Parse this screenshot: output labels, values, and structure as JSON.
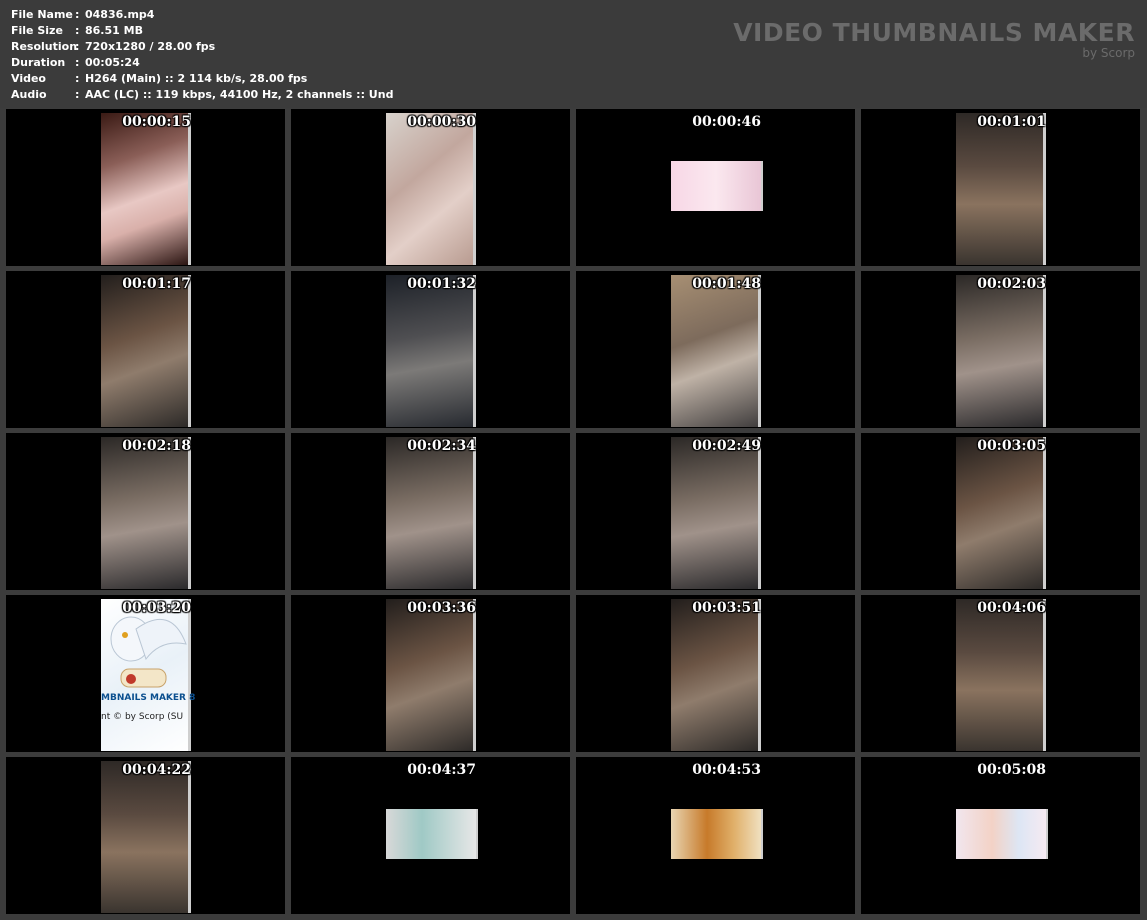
{
  "meta": {
    "rows": [
      {
        "key": "File Name",
        "sep": ":",
        "value": "04836.mp4"
      },
      {
        "key": "File Size",
        "sep": ":",
        "value": "86.51 MB"
      },
      {
        "key": "Resolution",
        "sep": ":",
        "value": "720x1280 / 28.00 fps"
      },
      {
        "key": "Duration",
        "sep": ":",
        "value": "00:05:24"
      },
      {
        "key": "Video",
        "sep": ":",
        "value": "H264 (Main) :: 2 114 kb/s, 28.00 fps"
      },
      {
        "key": "Audio",
        "sep": ":",
        "value": "AAC (LC) :: 119 kbps, 44100 Hz, 2 channels :: Und"
      }
    ]
  },
  "brand": {
    "title": "VIDEO THUMBNAILS MAKER",
    "by": "by Scorp"
  },
  "thumbnails": [
    {
      "time": "00:00:15"
    },
    {
      "time": "00:00:30"
    },
    {
      "time": "00:00:46"
    },
    {
      "time": "00:01:01"
    },
    {
      "time": "00:01:17"
    },
    {
      "time": "00:01:32"
    },
    {
      "time": "00:01:48"
    },
    {
      "time": "00:02:03"
    },
    {
      "time": "00:02:18"
    },
    {
      "time": "00:02:34"
    },
    {
      "time": "00:02:49"
    },
    {
      "time": "00:03:05"
    },
    {
      "time": "00:03:20",
      "overlay_line1": "MBNAILS MAKER 8",
      "overlay_line2": "nt © by Scorp (SU"
    },
    {
      "time": "00:03:36"
    },
    {
      "time": "00:03:51"
    },
    {
      "time": "00:04:06"
    },
    {
      "time": "00:04:22"
    },
    {
      "time": "00:04:37"
    },
    {
      "time": "00:04:53"
    },
    {
      "time": "00:05:08"
    }
  ]
}
